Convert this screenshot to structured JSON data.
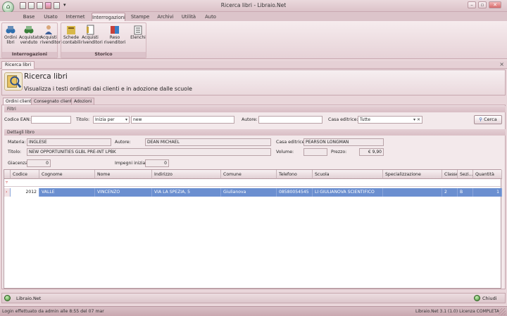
{
  "window": {
    "title": "Ricerca libri - Libraio.Net"
  },
  "ribbon_tabs": [
    "Base",
    "Usato",
    "Internet",
    "Interrogazioni",
    "Stampe",
    "Archivi",
    "Utilità",
    "Auto"
  ],
  "ribbon_groups": [
    {
      "label": "Interrogazioni",
      "buttons": [
        {
          "line1": "Ordini",
          "line2": "libri",
          "icon": "binoculars-icon"
        },
        {
          "line1": "Acquistato",
          "line2": "venduto",
          "icon": "binoculars-chart-icon"
        },
        {
          "line1": "Acquisti",
          "line2": "rivenditori",
          "icon": "person-icon"
        }
      ]
    },
    {
      "label": "Storico",
      "buttons": [
        {
          "line1": "Schede",
          "line2": "contabili",
          "icon": "ledger-icon"
        },
        {
          "line1": "Acquisti",
          "line2": "rivenditori",
          "icon": "document-icon"
        },
        {
          "line1": "Reso rivenditori",
          "line2": "",
          "icon": "book-return-icon"
        },
        {
          "line1": "Elenchi",
          "line2": "",
          "icon": "list-icon"
        }
      ]
    }
  ],
  "document_tab": "Ricerca libri",
  "header": {
    "title": "Ricerca libri",
    "subtitle": "Visualizza i testi ordinati dai clienti e in adozione dalle scuole"
  },
  "inner_tabs": [
    "Ordini clienti",
    "Consegnato clienti",
    "Adozioni"
  ],
  "filters": {
    "section": "Filtri",
    "ean_label": "Codice EAN:",
    "ean_value": "",
    "titolo_label": "Titolo:",
    "titolo_mode": "Inizia per",
    "titolo_value": "new",
    "autore_label": "Autore:",
    "autore_value": "",
    "casa_label": "Casa editrice:",
    "casa_value": "Tutte",
    "cerca_label": "Cerca"
  },
  "details": {
    "section": "Dettagli libro",
    "materia_label": "Materia:",
    "materia_value": "INGLESE",
    "autore_label": "Autore:",
    "autore_value": "DEAN MICHAEL",
    "casa_label": "Casa editrice:",
    "casa_value": "PEARSON LONGMAN",
    "titolo_label": "Titolo:",
    "titolo_value": "NEW OPPORTUNITIES GLBL PRE-INT LPBK",
    "volume_label": "Volume:",
    "volume_value": "",
    "prezzo_label": "Prezzo:",
    "prezzo_value": "€ 9,90",
    "giacenza_label": "Giacenza:",
    "giacenza_value": "0",
    "impegni_label": "Impegni iniziali:",
    "impegni_value": "0"
  },
  "grid": {
    "columns": [
      "Codice",
      "Cognome",
      "Nome",
      "Indirizzo",
      "Comune",
      "Telefono",
      "Scuola",
      "Specializzazione",
      "Classe",
      "Sezi...",
      "Quantità"
    ],
    "rows": [
      [
        "2012",
        "VALLE",
        "VINCENZO",
        "VIA LA SPEZIA, 5",
        "Giulianova",
        "08580054545",
        "LI GIULIANOVA SCIENTIFICO",
        "",
        "2",
        "B",
        "1"
      ]
    ]
  },
  "footer": {
    "app_label": "Libraio.Net",
    "close_label": "Chiudi"
  },
  "status": {
    "left": "Login effettuato da admin alle 8:55 del 07 mar",
    "right": "Libraio.Net 3.1 (1.0) Licenza COMPLETA"
  }
}
